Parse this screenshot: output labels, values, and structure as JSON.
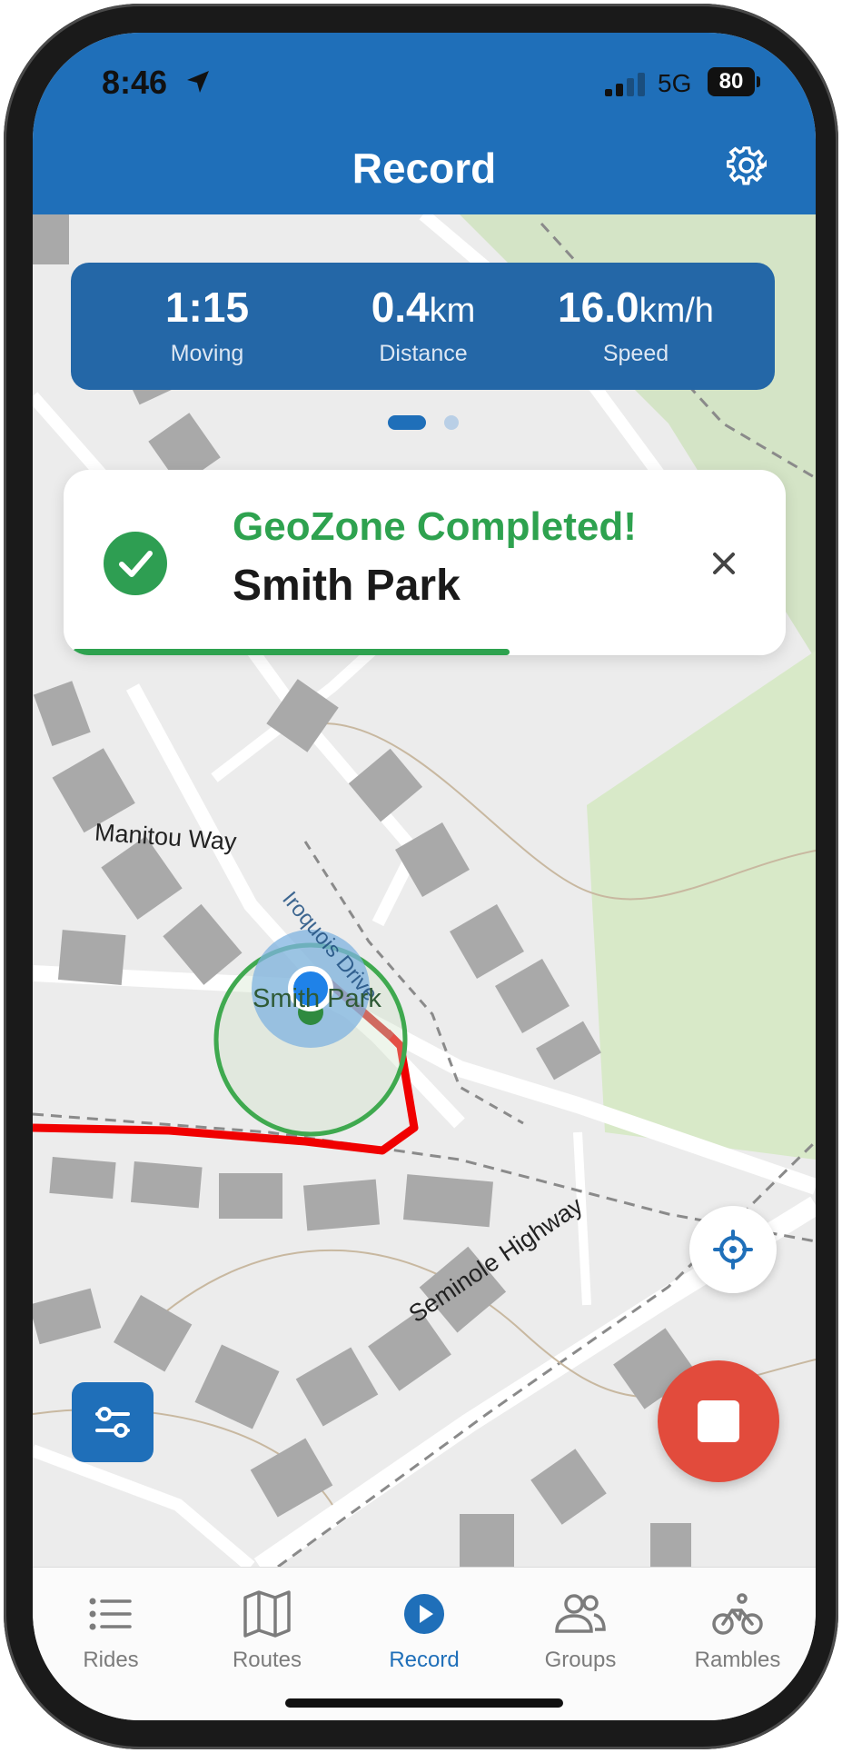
{
  "status_bar": {
    "time": "8:46",
    "network": "5G",
    "battery": "80"
  },
  "header": {
    "title": "Record"
  },
  "stats": [
    {
      "value": "1:15",
      "unit": "",
      "label": "Moving"
    },
    {
      "value": "0.4",
      "unit": "km",
      "label": "Distance"
    },
    {
      "value": "16.0",
      "unit": "km/h",
      "label": "Speed"
    }
  ],
  "pager": {
    "pages": 2,
    "active": 1
  },
  "toast": {
    "heading": "GeoZone Completed!",
    "name": "Smith Park",
    "progress": 0.62
  },
  "map": {
    "labels": {
      "manitou": "Manitou Way",
      "seminole": "Seminole Highway",
      "iroquois": "Iroquois Drive",
      "park": "Smith Park"
    }
  },
  "tabs": [
    {
      "label": "Rides",
      "icon": "list-icon",
      "active": false
    },
    {
      "label": "Routes",
      "icon": "map-icon",
      "active": false
    },
    {
      "label": "Record",
      "icon": "record-play-icon",
      "active": true
    },
    {
      "label": "Groups",
      "icon": "groups-icon",
      "active": false
    },
    {
      "label": "Rambles",
      "icon": "bike-rider-icon",
      "active": false
    }
  ],
  "colors": {
    "brand": "#1f6fb9",
    "success": "#2ea24f",
    "stop": "#e24b3c",
    "route": "#f00000"
  }
}
